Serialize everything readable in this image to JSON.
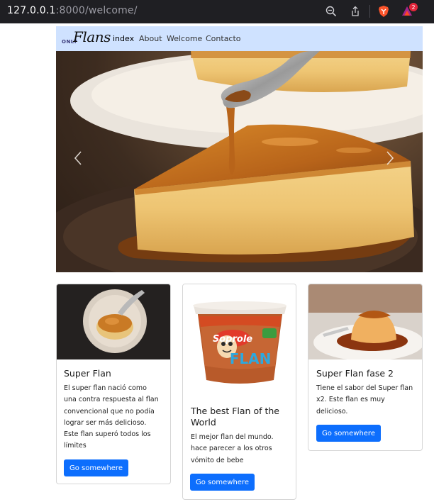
{
  "browser": {
    "url_host": "127.0.0.1",
    "url_rest": ":8000/welcome/",
    "notification_count": "2"
  },
  "navbar": {
    "brand_small": "ONLY",
    "brand_main": "Flans",
    "links": [
      "index",
      "About",
      "Welcome",
      "Contacto"
    ]
  },
  "carousel": {
    "prev_icon": "chevron-left-icon",
    "next_icon": "chevron-right-icon"
  },
  "cards": [
    {
      "title": "Super Flan",
      "lines": [
        "El super flan nació como",
        "una contra respuesta al flan",
        "convencional que no podía",
        "lograr ser más delicioso.",
        "Este flan superó todos los",
        "límites"
      ],
      "button": "Go somewhere"
    },
    {
      "title_lines": [
        "The best Flan of the",
        "World"
      ],
      "lines": [
        "El mejor flan del mundo.",
        "hace parecer a los otros",
        "vómito de bebe"
      ],
      "button": "Go somewhere",
      "image_text": {
        "brand": "Soprole",
        "product": "FLAN"
      }
    },
    {
      "title": "Super Flan fase 2",
      "lines": [
        "Tiene el sabor del Super flan",
        "x2. Este flan es muy",
        "delicioso."
      ],
      "button": "Go somewhere"
    }
  ],
  "colors": {
    "primary": "#0d6efd",
    "navbar_bg": "#cfe2ff",
    "browser_bg": "#1f1f23"
  }
}
